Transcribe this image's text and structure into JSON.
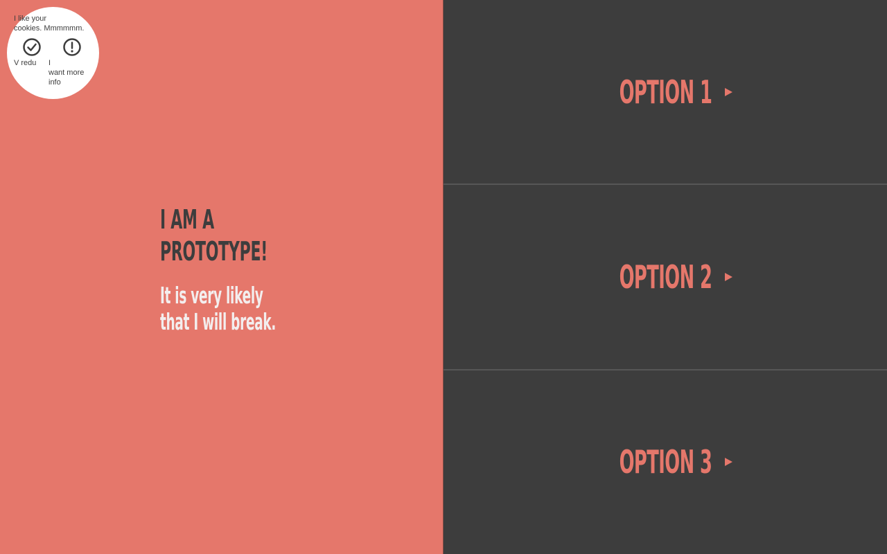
{
  "hero": {
    "title_line1": "I AM A",
    "title_line2": "PROTOTYPE!",
    "subtitle_line1": "It is very likely",
    "subtitle_line2": "that I will break."
  },
  "cookie": {
    "message_line1": "I like your",
    "message_line2": "cookies. Mmmmmm.",
    "accept_label": "V redu",
    "accept_icon": "check-circle-icon",
    "info_label_line1": "I",
    "info_label_line2": "want more",
    "info_label_line3": "info",
    "info_icon": "exclamation-circle-icon"
  },
  "options": [
    {
      "label": "OPTION 1",
      "icon": "play-arrow-icon"
    },
    {
      "label": "OPTION 2",
      "icon": "play-arrow-icon"
    },
    {
      "label": "OPTION 3",
      "icon": "play-arrow-icon"
    }
  ],
  "colors": {
    "accent": "#e5776b",
    "dark": "#3d3d3d",
    "light_text": "#f3eeee",
    "bubble": "#ffffff",
    "divider": "#575757"
  }
}
